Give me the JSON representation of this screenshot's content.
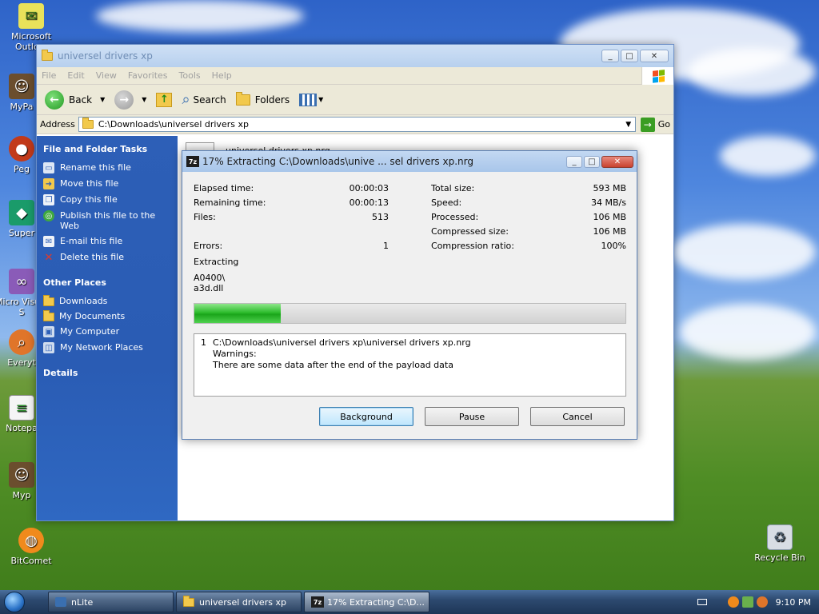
{
  "desktop": {
    "icons": [
      {
        "label": "Microsoft Outlo..."
      },
      {
        "label": "MyPa"
      },
      {
        "label": "Peg"
      },
      {
        "label": "Super"
      },
      {
        "label": "Micro Visual S"
      },
      {
        "label": "Everyt"
      },
      {
        "label": "Notepa"
      },
      {
        "label": "Myp"
      },
      {
        "label": "BitComet"
      },
      {
        "label": "Recycle Bin"
      }
    ]
  },
  "explorer": {
    "title": "universel drivers xp",
    "menu": [
      "File",
      "Edit",
      "View",
      "Favorites",
      "Tools",
      "Help"
    ],
    "toolbar": {
      "back": "Back",
      "search": "Search",
      "folders": "Folders"
    },
    "address": {
      "label": "Address",
      "value": "C:\\Downloads\\universel drivers xp",
      "go": "Go"
    },
    "tasks": {
      "heading": "File and Folder Tasks",
      "items": [
        "Rename this file",
        "Move this file",
        "Copy this file",
        "Publish this file to the Web",
        "E-mail this file",
        "Delete this file"
      ]
    },
    "other_places": {
      "heading": "Other Places",
      "items": [
        "Downloads",
        "My Documents",
        "My Computer",
        "My Network Places"
      ]
    },
    "details_heading": "Details",
    "file_name": "universel drivers xp.nrg"
  },
  "dialog": {
    "title": "17% Extracting C:\\Downloads\\unive ... sel drivers xp.nrg",
    "left_stats": [
      {
        "label": "Elapsed time:",
        "value": "00:00:03"
      },
      {
        "label": "Remaining time:",
        "value": "00:00:13"
      },
      {
        "label": "Files:",
        "value": "513"
      },
      {
        "label": "Errors:",
        "value": "1"
      }
    ],
    "right_stats": [
      {
        "label": "Total size:",
        "value": "593 MB"
      },
      {
        "label": "Speed:",
        "value": "34 MB/s"
      },
      {
        "label": "Processed:",
        "value": "106 MB"
      },
      {
        "label": "Compressed size:",
        "value": "106 MB"
      },
      {
        "label": "Compression ratio:",
        "value": "100%"
      }
    ],
    "status_label": "Extracting",
    "current_path": "A0400\\",
    "current_file": "a3d.dll",
    "progress_fraction": 0.2,
    "messages": {
      "index": "1",
      "path": "C:\\Downloads\\universel drivers xp\\universel drivers xp.nrg",
      "warning_label": "Warnings:",
      "warning_text": "There are some data after the end of the payload data"
    },
    "buttons": {
      "background": "Background",
      "pause": "Pause",
      "cancel": "Cancel"
    }
  },
  "taskbar": {
    "items": [
      {
        "label": "nLite"
      },
      {
        "label": "universel drivers xp"
      },
      {
        "label": "17% Extracting C:\\D..."
      }
    ],
    "clock": "9:10 PM"
  },
  "colors": {
    "taskpane_blue": "#2d5fb7",
    "progress_green": "#2ebd2e",
    "taskbar_blue": "#2d4a70"
  }
}
